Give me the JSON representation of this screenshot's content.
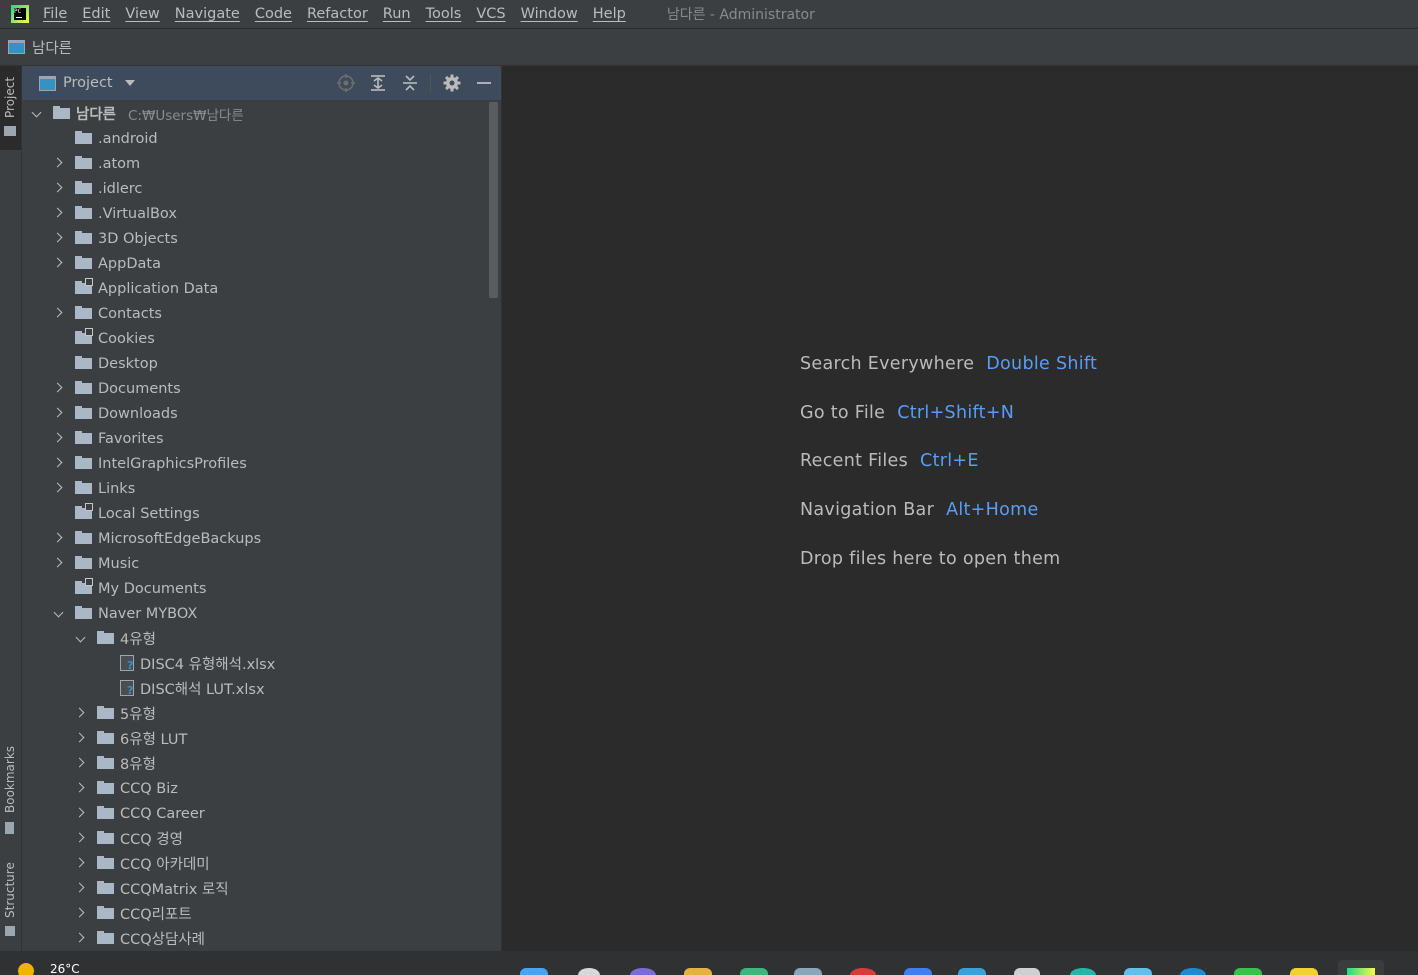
{
  "menubar": {
    "items": [
      "File",
      "Edit",
      "View",
      "Navigate",
      "Code",
      "Refactor",
      "Run",
      "Tools",
      "VCS",
      "Window",
      "Help"
    ],
    "window_title": "남다른 - Administrator",
    "app_icon": "pycharm-logo-icon"
  },
  "navbar": {
    "project_name": "남다른"
  },
  "tool_stripe": {
    "project": "Project",
    "bookmarks": "Bookmarks",
    "structure": "Structure"
  },
  "project_panel": {
    "title": "Project",
    "header_icons": [
      "locate-icon",
      "expand-all-icon",
      "collapse-all-icon",
      "gear-icon",
      "minimize-icon"
    ],
    "root": {
      "name": "남다른",
      "path": "C:₩Users₩남다른"
    },
    "tree": [
      {
        "label": "남다른",
        "arrow": "down",
        "icon": "folder"
      },
      {
        "label": ".android",
        "arrow": "none",
        "icon": "folder"
      },
      {
        "label": ".atom",
        "arrow": "right",
        "icon": "folder"
      },
      {
        "label": ".idlerc",
        "arrow": "right",
        "icon": "folder"
      },
      {
        "label": ".VirtualBox",
        "arrow": "right",
        "icon": "folder"
      },
      {
        "label": "3D Objects",
        "arrow": "right",
        "icon": "folder"
      },
      {
        "label": "AppData",
        "arrow": "right",
        "icon": "folder"
      },
      {
        "label": "Application Data",
        "arrow": "none",
        "icon": "folder-link"
      },
      {
        "label": "Contacts",
        "arrow": "right",
        "icon": "folder"
      },
      {
        "label": "Cookies",
        "arrow": "none",
        "icon": "folder-link"
      },
      {
        "label": "Desktop",
        "arrow": "none",
        "icon": "folder"
      },
      {
        "label": "Documents",
        "arrow": "right",
        "icon": "folder"
      },
      {
        "label": "Downloads",
        "arrow": "right",
        "icon": "folder"
      },
      {
        "label": "Favorites",
        "arrow": "right",
        "icon": "folder"
      },
      {
        "label": "IntelGraphicsProfiles",
        "arrow": "right",
        "icon": "folder"
      },
      {
        "label": "Links",
        "arrow": "right",
        "icon": "folder"
      },
      {
        "label": "Local Settings",
        "arrow": "none",
        "icon": "folder-link"
      },
      {
        "label": "MicrosoftEdgeBackups",
        "arrow": "right",
        "icon": "folder"
      },
      {
        "label": "Music",
        "arrow": "right",
        "icon": "folder"
      },
      {
        "label": "My Documents",
        "arrow": "none",
        "icon": "folder-link"
      },
      {
        "label": "Naver MYBOX",
        "arrow": "down",
        "icon": "folder"
      },
      {
        "label": "4유형",
        "arrow": "down",
        "icon": "folder"
      },
      {
        "label": "DISC4 유형해석.xlsx",
        "arrow": "none",
        "icon": "file-unknown"
      },
      {
        "label": "DISC해석 LUT.xlsx",
        "arrow": "none",
        "icon": "file-unknown"
      },
      {
        "label": "5유형",
        "arrow": "right",
        "icon": "folder"
      },
      {
        "label": "6유형 LUT",
        "arrow": "right",
        "icon": "folder"
      },
      {
        "label": "8유형",
        "arrow": "right",
        "icon": "folder"
      },
      {
        "label": "CCQ Biz",
        "arrow": "right",
        "icon": "folder"
      },
      {
        "label": "CCQ Career",
        "arrow": "right",
        "icon": "folder"
      },
      {
        "label": "CCQ 경영",
        "arrow": "right",
        "icon": "folder"
      },
      {
        "label": "CCQ 아카데미",
        "arrow": "right",
        "icon": "folder"
      },
      {
        "label": "CCQMatrix 로직",
        "arrow": "right",
        "icon": "folder"
      },
      {
        "label": "CCQ리포트",
        "arrow": "right",
        "icon": "folder"
      },
      {
        "label": "CCQ상담사례",
        "arrow": "right",
        "icon": "folder"
      }
    ]
  },
  "editor": {
    "hints": [
      {
        "text": "Search Everywhere",
        "key": "Double Shift"
      },
      {
        "text": "Go to File",
        "key": "Ctrl+Shift+N"
      },
      {
        "text": "Recent Files",
        "key": "Ctrl+E"
      },
      {
        "text": "Navigation Bar",
        "key": "Alt+Home"
      },
      {
        "text": "Drop files here to open them",
        "key": ""
      }
    ]
  },
  "taskbar": {
    "temperature": "26°C"
  },
  "colors": {
    "background": "#2b2b2b",
    "panel": "#3c3f41",
    "panel_header_selected": "#3d4b5c",
    "text": "#bbbbbb",
    "shortcut": "#589df6"
  }
}
